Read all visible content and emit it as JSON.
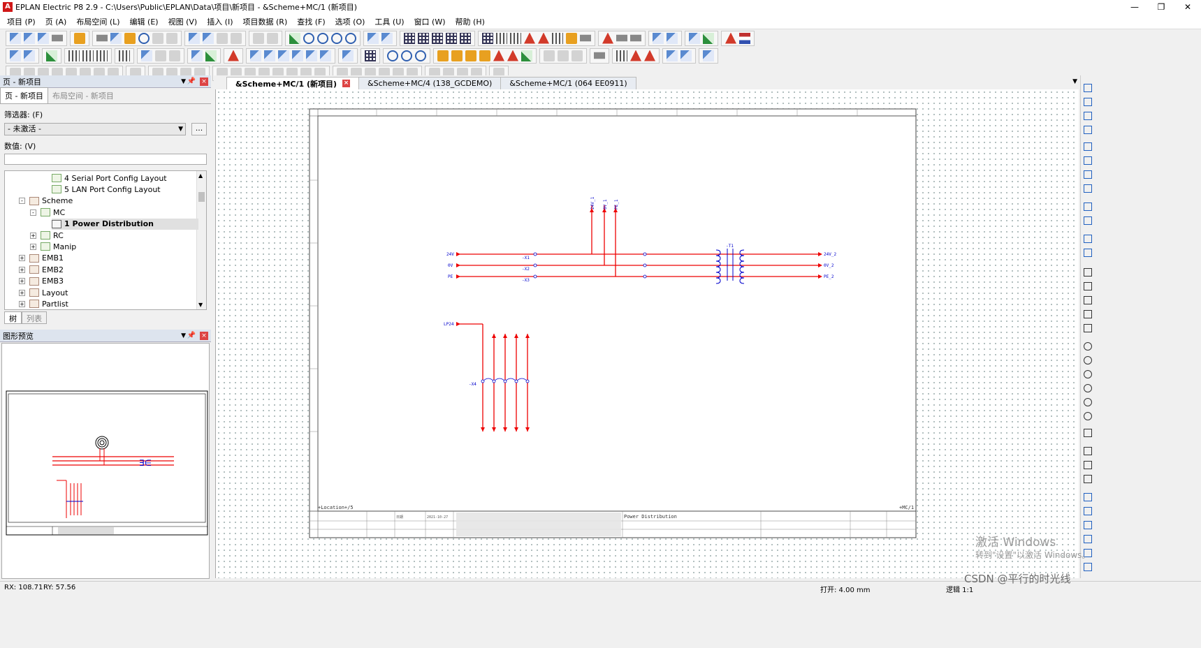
{
  "window": {
    "title": "EPLAN Electric P8 2.9 - C:\\Users\\Public\\EPLAN\\Data\\项目\\新项目 - &Scheme+MC/1 (新项目)",
    "app_icon": "A"
  },
  "menu": [
    "项目 (P)",
    "页 (A)",
    "布局空间 (L)",
    "编辑 (E)",
    "视图 (V)",
    "插入 (I)",
    "项目数据 (R)",
    "查找 (F)",
    "选项 (O)",
    "工具 (U)",
    "窗口 (W)",
    "帮助 (H)"
  ],
  "pages_panel": {
    "title": "页 - 新项目",
    "tabs": [
      "页 - 新项目",
      "布局空间 - 新项目"
    ],
    "filter_label": "筛选器: (F)",
    "filter_value": "- 未激活 -",
    "filter_button": "...",
    "value_label": "数值: (V)",
    "tree": [
      {
        "label": "4 Serial Port Config Layout",
        "indent": 3,
        "icon": "layout"
      },
      {
        "label": "5 LAN Port Config Layout",
        "indent": 3,
        "icon": "layout"
      },
      {
        "label": "Scheme",
        "indent": 1,
        "icon": "folder",
        "expander": "-"
      },
      {
        "label": "MC",
        "indent": 2,
        "icon": "group",
        "expander": "-"
      },
      {
        "label": "1 Power Distribution",
        "indent": 3,
        "icon": "page",
        "selected": true
      },
      {
        "label": "RC",
        "indent": 2,
        "icon": "group",
        "expander": "+"
      },
      {
        "label": "Manip",
        "indent": 2,
        "icon": "group",
        "expander": "+"
      },
      {
        "label": "EMB1",
        "indent": 1,
        "icon": "folder",
        "expander": "+"
      },
      {
        "label": "EMB2",
        "indent": 1,
        "icon": "folder",
        "expander": "+"
      },
      {
        "label": "EMB3",
        "indent": 1,
        "icon": "folder",
        "expander": "+"
      },
      {
        "label": "Layout",
        "indent": 1,
        "icon": "folder",
        "expander": "+"
      },
      {
        "label": "Partlist",
        "indent": 1,
        "icon": "folder",
        "expander": "+"
      }
    ],
    "view_tabs": [
      "树",
      "列表"
    ]
  },
  "preview_panel": {
    "title": "图形预览"
  },
  "doc_tabs": [
    {
      "label": "&Scheme+MC/1 (新项目)",
      "active": true
    },
    {
      "label": "&Scheme+MC/4 (138_GCDEMO)",
      "active": false
    },
    {
      "label": "&Scheme+MC/1 (064 EE0911)",
      "active": false
    }
  ],
  "schematic": {
    "bus_labels_left": [
      "24V",
      "0V",
      "PE"
    ],
    "bus_labels_right": [
      "24V_2",
      "0V_2",
      "PE_2"
    ],
    "terminal_labels": [
      "-X1",
      "-X2",
      "-X3"
    ],
    "transformer_label": "-T1",
    "top_labels": [
      "24V_1",
      "0V_1",
      "PE_1"
    ],
    "lp_label": "LP24",
    "x4_label": "-X4",
    "title_block": {
      "location": "+Location+/5",
      "page_title": "Power Distribution",
      "page_ref": "+MC/1",
      "date_label": "日期",
      "date_value": "2021-10-27"
    }
  },
  "status": {
    "rx": "RX: 108.71",
    "ry": "RY: 57.56",
    "grid": "打开: 4.00 mm",
    "logic": "逻辑 1:1"
  },
  "watermark": {
    "line1": "激活 Windows",
    "line2": "转到\"设置\"以激活 Windows。",
    "credit": "CSDN @平行的时光线"
  }
}
